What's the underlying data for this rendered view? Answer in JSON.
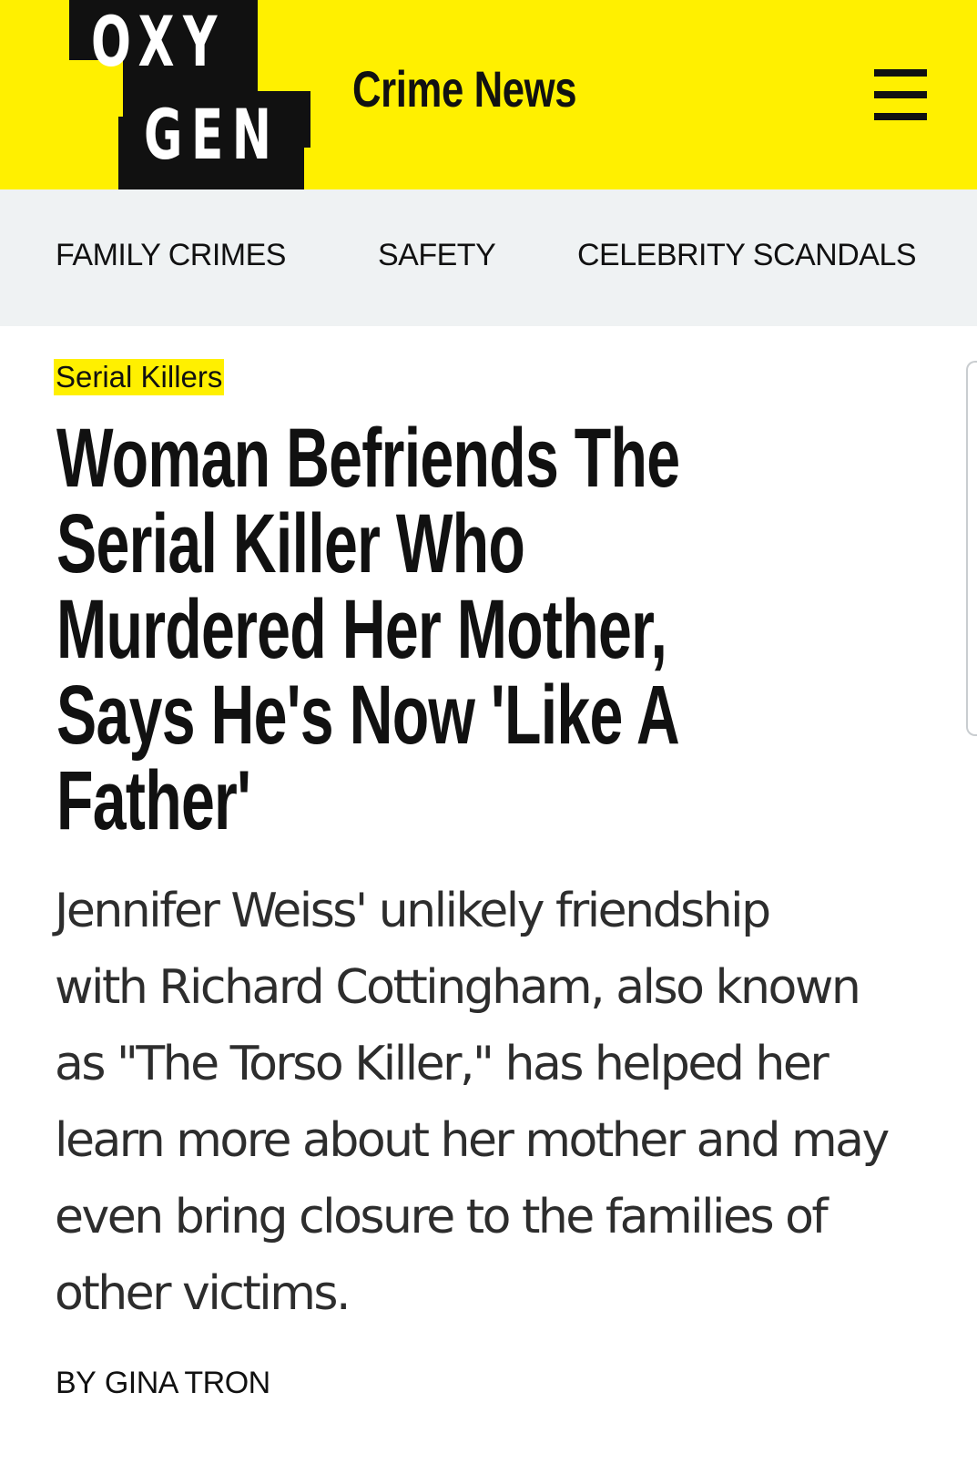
{
  "header": {
    "logo_top": "OXY",
    "logo_bottom": "GEN",
    "section_title": "Crime News",
    "menu_icon": "hamburger-menu-icon",
    "colors": {
      "brand_yellow": "#fff000",
      "logo_black": "#111111",
      "nav_background": "#eff2f3"
    }
  },
  "nav": {
    "items": [
      {
        "label": "FAMILY CRIMES"
      },
      {
        "label": "SAFETY"
      },
      {
        "label": "CELEBRITY SCANDALS"
      }
    ]
  },
  "article": {
    "category": "Serial Killers",
    "headline_lines": [
      "Woman Befriends The",
      "Serial Killer Who",
      "Murdered Her Mother,",
      "Says He's Now 'Like A",
      "Father'"
    ],
    "summary_lines": [
      "Jennifer Weiss' unlikely friendship",
      "with Richard Cottingham, also known",
      "as \"The Torso Killer,\" has helped her",
      "learn more about her mother and may",
      "even bring closure to the families of",
      "other victims."
    ],
    "byline_prefix": "BY",
    "author": "GINA TRON"
  }
}
